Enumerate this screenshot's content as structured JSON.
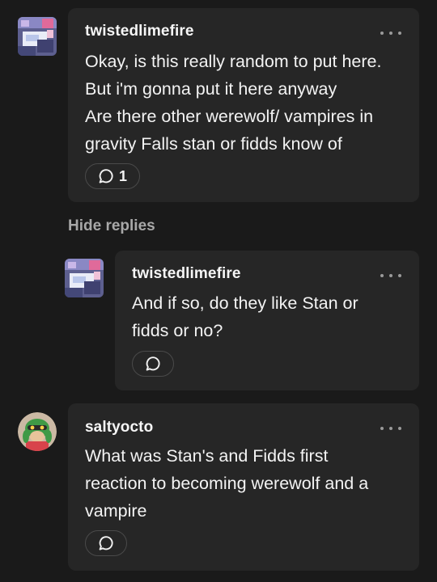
{
  "comments": [
    {
      "username": "twistedlimefire",
      "text": "Okay, is this really random to put here.\nBut i'm gonna put it here anyway\nAre there other werewolf/ vampires in\ngravity Falls stan or fidds know of",
      "reply_count": "1",
      "avatar_icon": "avatar-bedroom-image",
      "more_icon": "more-options-icon",
      "reply_icon": "speech-bubble-icon"
    },
    {
      "username": "twistedlimefire",
      "text": "And if so, do they like Stan or\nfidds or no?",
      "avatar_icon": "avatar-bedroom-image",
      "more_icon": "more-options-icon",
      "reply_icon": "speech-bubble-icon"
    },
    {
      "username": "saltyocto",
      "text": "What was Stan's and Fidds first\nreaction to becoming werewolf and a\nvampire",
      "avatar_icon": "avatar-octoling-image",
      "more_icon": "more-options-icon",
      "reply_icon": "speech-bubble-icon"
    }
  ],
  "hide_replies_label": "Hide replies",
  "colors": {
    "background": "#1a1a1a",
    "card": "#262626",
    "text": "#f3f3f3",
    "muted": "#a8a8a8"
  }
}
